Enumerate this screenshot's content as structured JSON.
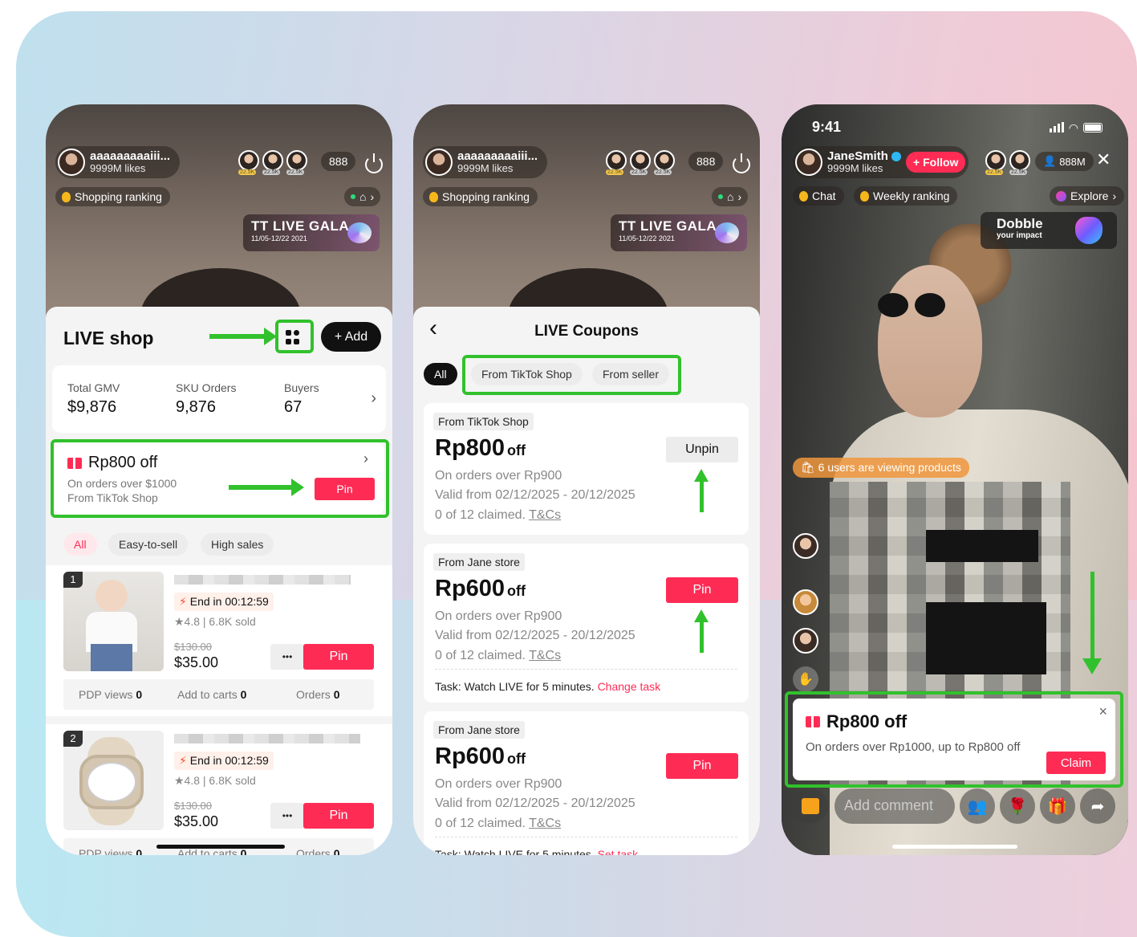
{
  "live_header": {
    "streamer_name": "aaaaaaaaaiii...",
    "likes": "9999M likes",
    "viewer_badge": "22.5K",
    "viewer_count": "888",
    "shopping_ranking": "Shopping ranking",
    "gala_title": "TT LIVE GALA",
    "gala_dates": "11/05-12/22 2021"
  },
  "shop_panel": {
    "title": "LIVE shop",
    "add_label": "+ Add",
    "stats": [
      {
        "label": "Total GMV",
        "value": "$9,876"
      },
      {
        "label": "SKU Orders",
        "value": "9,876"
      },
      {
        "label": "Buyers",
        "value": "67"
      }
    ],
    "coupon": {
      "title": "Rp800 off",
      "line1": "On orders over $1000",
      "line2": "From TikTok Shop",
      "pin": "Pin"
    },
    "filters": [
      "All",
      "Easy-to-sell",
      "High sales"
    ],
    "products": [
      {
        "rank": "1",
        "timer": "End in 00:12:59",
        "rating": "★4.8 | 6.8K sold",
        "old_price": "$130.00",
        "price": "$35.00",
        "more": "•••",
        "pin": "Pin",
        "metrics": [
          {
            "label": "PDP views",
            "value": "0"
          },
          {
            "label": "Add to carts",
            "value": "0"
          },
          {
            "label": "Orders",
            "value": "0"
          }
        ]
      },
      {
        "rank": "2",
        "timer": "End in 00:12:59",
        "rating": "★4.8 | 6.8K sold",
        "old_price": "$130.00",
        "price": "$35.00",
        "more": "•••",
        "pin": "Pin",
        "metrics": [
          {
            "label": "PDP views",
            "value": "0"
          },
          {
            "label": "Add to carts",
            "value": "0"
          },
          {
            "label": "Orders",
            "value": "0"
          }
        ]
      }
    ]
  },
  "coupons_panel": {
    "back": "‹",
    "title": "LIVE Coupons",
    "filters": [
      "All",
      "From TikTok Shop",
      "From seller"
    ],
    "items": [
      {
        "source": "From TikTok Shop",
        "amount": "Rp800",
        "suffix": "off",
        "min": "On orders over Rp900",
        "valid": "Valid from 02/12/2025 - 20/12/2025",
        "claimed": "0 of 12 claimed.",
        "tcs": "T&Cs",
        "action": "Unpin",
        "task": "",
        "task_link": ""
      },
      {
        "source": "From Jane store",
        "amount": "Rp600",
        "suffix": "off",
        "min": "On orders over Rp900",
        "valid": "Valid from 02/12/2025 - 20/12/2025",
        "claimed": "0 of 12 claimed.",
        "tcs": "T&Cs",
        "action": "Pin",
        "task": "Task: Watch LIVE for 5 minutes.",
        "task_link": "Change task"
      },
      {
        "source": "From Jane store",
        "amount": "Rp600",
        "suffix": "off",
        "min": "On orders over Rp900",
        "valid": "Valid from 02/12/2025 - 20/12/2025",
        "claimed": "0 of 12 claimed.",
        "tcs": "T&Cs",
        "action": "Pin",
        "task": "Task: Watch LIVE for 5 minutes.",
        "task_link": "Set task"
      }
    ]
  },
  "viewer_screen": {
    "time": "9:41",
    "streamer_name": "JaneSmith",
    "likes": "9999M likes",
    "follow": "+ Follow",
    "viewer_badge": "22.5K",
    "viewer_count": "888M",
    "close": "✕",
    "chat": "Chat",
    "weekly_ranking": "Weekly ranking",
    "explore": "Explore",
    "promo_title": "Dobble",
    "promo_sub": "your impact",
    "viewing_banner": "6 users  are viewing products",
    "coupon_title": "Rp800 off",
    "coupon_desc": "On orders over Rp1000, up to Rp800 off",
    "claim": "Claim",
    "dismiss": "×",
    "comment_placeholder": "Add comment"
  },
  "colors": {
    "accent": "#fe2c55",
    "highlight": "#31c12c"
  }
}
